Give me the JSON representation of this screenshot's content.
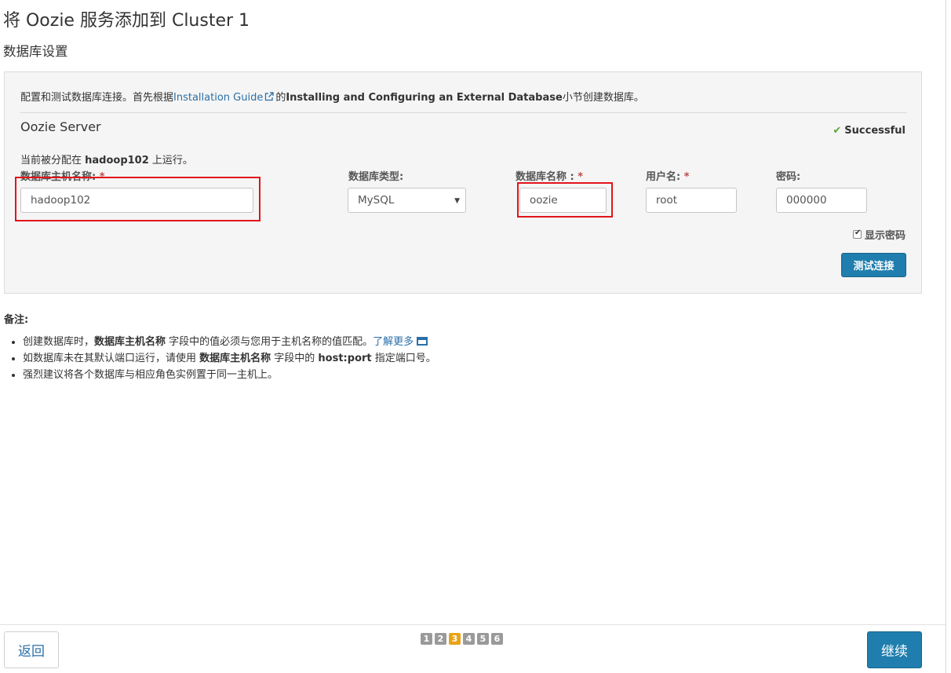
{
  "page": {
    "title": "将 Oozie 服务添加到 Cluster 1",
    "subtitle": "数据库设置"
  },
  "panel": {
    "intro_prefix": "配置和测试数据库连接。首先根据",
    "guide_link": "Installation Guide",
    "intro_mid": "的",
    "intro_bold": "Installing and Configuring an External Database",
    "intro_suffix": "小节创建数据库。",
    "section_title": "Oozie Server",
    "status": "Successful",
    "assigned_prefix": "当前被分配在 ",
    "assigned_host": "hadoop102",
    "assigned_suffix": " 上运行。"
  },
  "fields": {
    "host": {
      "label": "数据库主机名称:",
      "required": "*",
      "value": "hadoop102"
    },
    "db_type": {
      "label": "数据库类型:",
      "value": "MySQL"
    },
    "db_name": {
      "label": "数据库名称 :",
      "required": "*",
      "value": "oozie"
    },
    "username": {
      "label": "用户名:",
      "required": "*",
      "value": "root"
    },
    "password": {
      "label": "密码:",
      "value": "000000"
    }
  },
  "show_password": {
    "label": "显示密码",
    "checked": true
  },
  "buttons": {
    "test_connection": "测试连接",
    "back": "返回",
    "next": "继续"
  },
  "notes": {
    "title": "备注:",
    "item1_prefix": "创建数据库时，",
    "item1_bold": "数据库主机名称",
    "item1_suffix": " 字段中的值必须与您用于主机名称的值匹配。",
    "item1_link": "了解更多",
    "item2_prefix": "如数据库未在其默认端口运行，请使用 ",
    "item2_bold1": "数据库主机名称",
    "item2_mid": " 字段中的 ",
    "item2_bold2": "host:port",
    "item2_suffix": " 指定端口号。",
    "item3": "强烈建议将各个数据库与相应角色实例置于同一主机上。"
  },
  "wizard_steps": [
    "1",
    "2",
    "3",
    "4",
    "5",
    "6"
  ],
  "active_step": "3",
  "colors": {
    "primary": "#1f7eae",
    "link": "#2a6fa8",
    "success": "#5aa642",
    "active_step": "#e8a318",
    "highlight": "#e3141b"
  }
}
